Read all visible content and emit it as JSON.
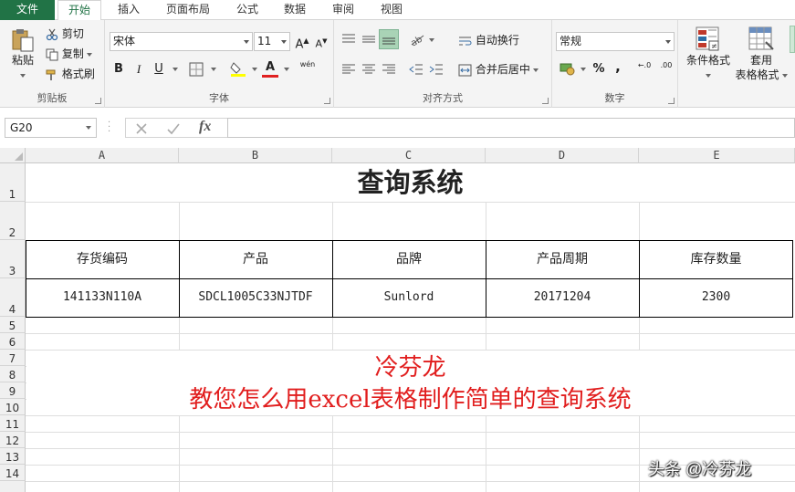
{
  "tabs": [
    "文件",
    "开始",
    "插入",
    "页面布局",
    "公式",
    "数据",
    "审阅",
    "视图"
  ],
  "clipboard": {
    "paste": "粘贴",
    "cut": "剪切",
    "copy": "复制",
    "painter": "格式刷",
    "label": "剪贴板"
  },
  "font": {
    "name": "宋体",
    "size": "11",
    "label": "字体",
    "bold": "B",
    "italic": "I",
    "underline": "U",
    "grow": "A",
    "shrink": "A",
    "phonetic": "wén",
    "fontcolor": "A"
  },
  "align": {
    "wrap": "自动换行",
    "merge": "合并后居中",
    "label": "对齐方式"
  },
  "number": {
    "format": "常规",
    "percent": "%",
    "comma": ",",
    "label": "数字",
    "inc": "←.0",
    "dec": ".00"
  },
  "styles": {
    "cond": "条件格式",
    "table_l1": "套用",
    "table_l2": "表格格式"
  },
  "formula_bar": {
    "name_box": "G20",
    "fx": "fx",
    "value": ""
  },
  "columns": [
    "A",
    "B",
    "C",
    "D",
    "E"
  ],
  "rows": [
    "1",
    "2",
    "3",
    "4",
    "5",
    "6",
    "7",
    "8",
    "9",
    "10",
    "11",
    "12",
    "13",
    "14"
  ],
  "sheet": {
    "title": "查询系统",
    "headers": [
      "存货编码",
      "产品",
      "品牌",
      "产品周期",
      "库存数量"
    ],
    "row": [
      "141133N110A",
      "SDCL1005C33NJTDF",
      "Sunlord",
      "20171204",
      "2300"
    ],
    "red_line1": "冷芬龙",
    "red_line2": "教您怎么用excel表格制作简单的查询系统"
  },
  "watermark": "头条 @冷芬龙",
  "colors": {
    "excel_green": "#217346",
    "red_text": "#e11d1d",
    "highlight": "#a9d3b6"
  }
}
